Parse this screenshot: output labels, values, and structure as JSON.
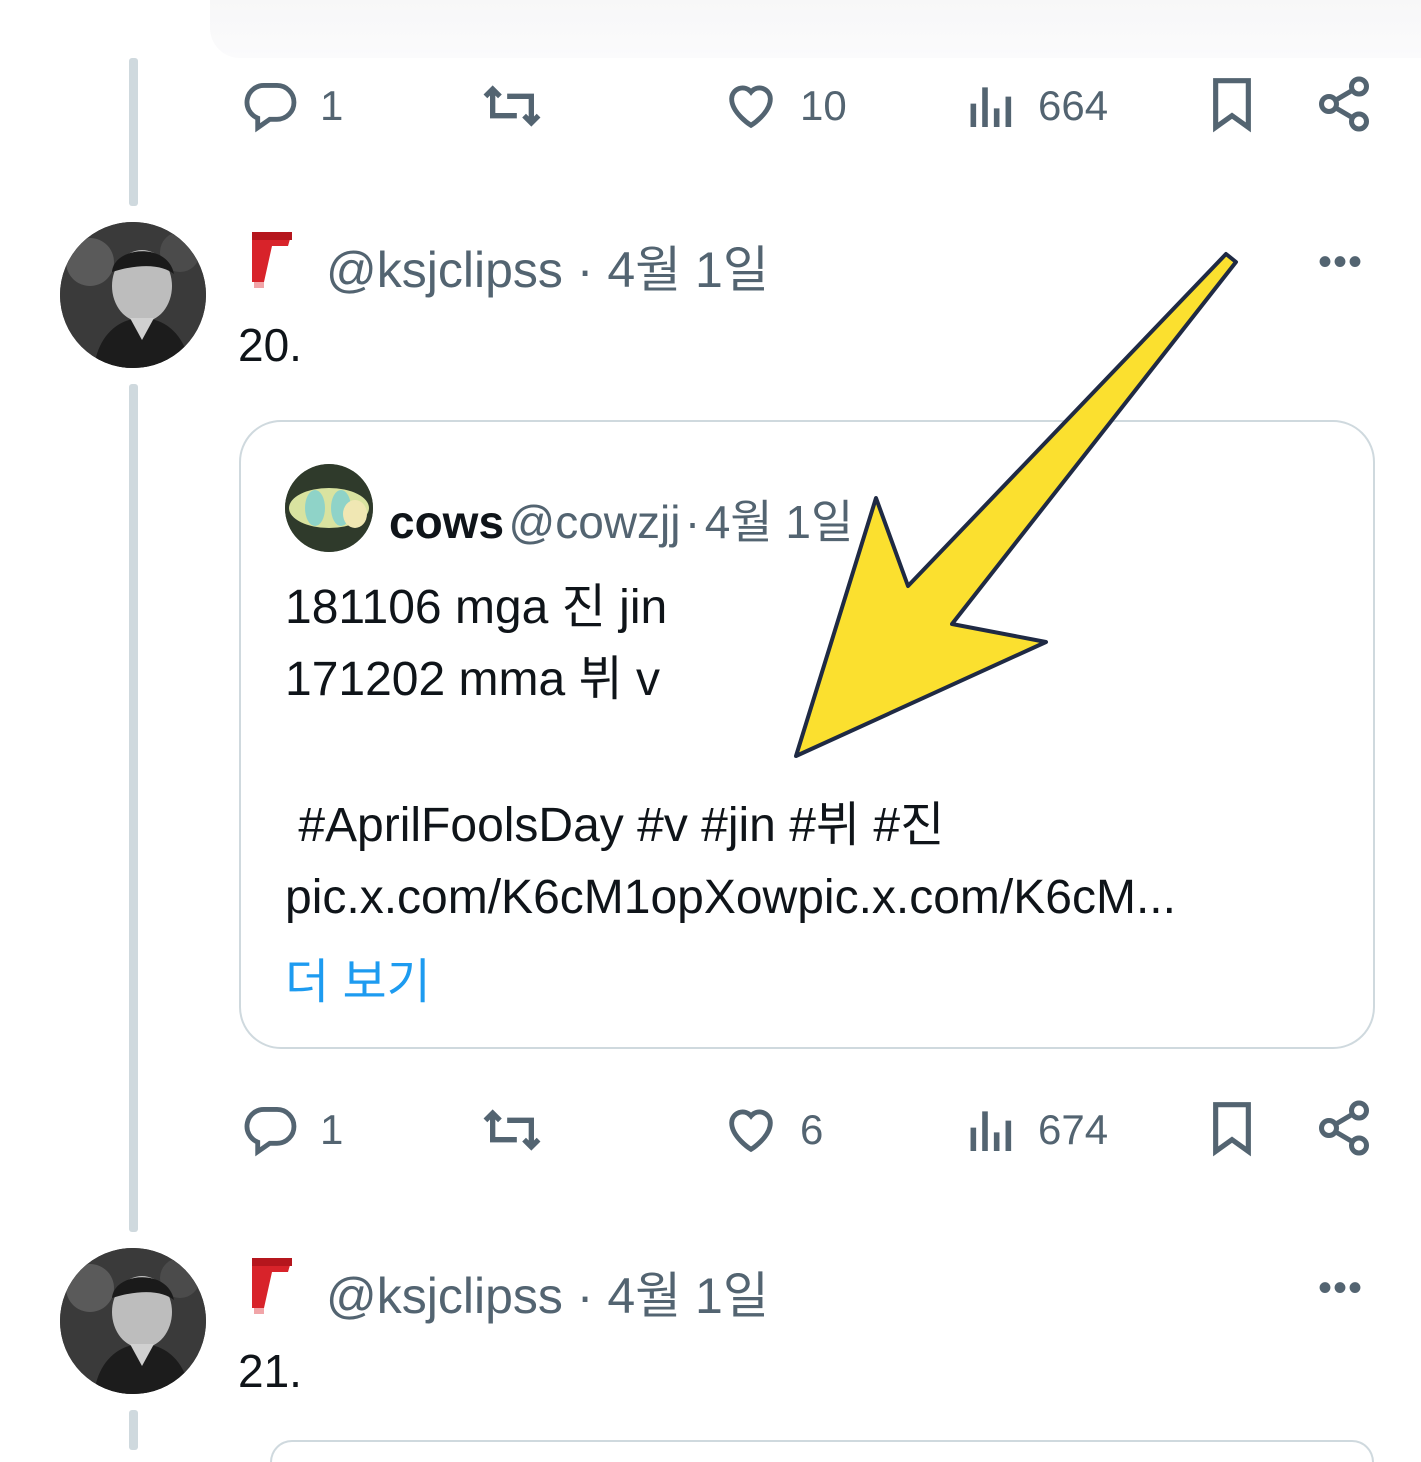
{
  "top_action_bar": {
    "reply_count": "1",
    "retweet_count": "",
    "like_count": "10",
    "view_count": "664"
  },
  "tweet_20": {
    "handle": "@ksjclipss",
    "separator": "·",
    "date": "4월 1일",
    "text": "20.",
    "more_label": "•••",
    "quote": {
      "name": "cows",
      "handle": "@cowzjj",
      "separator": "·",
      "date": "4월 1일",
      "line1": "181106 mga 진 jin",
      "line2": "171202 mma 뷔 v",
      "hashtags": " #AprilFoolsDay #v #jin #뷔 #진",
      "link": "pic.x.com/K6cM1opXowpic.x.com/K6cM...",
      "show_more": "더 보기"
    },
    "actions": {
      "reply_count": "1",
      "like_count": "6",
      "view_count": "674"
    }
  },
  "tweet_21": {
    "handle": "@ksjclipss",
    "separator": "·",
    "date": "4월 1일",
    "text": "21.",
    "more_label": "•••"
  },
  "colors": {
    "secondary_text": "#536471",
    "link_blue": "#1d9bf0",
    "thread_line": "#cfd9de",
    "arrow_fill": "#fbe02f",
    "scarf_red": "#d8232a"
  },
  "icons": [
    "reply-icon",
    "retweet-icon",
    "like-icon",
    "views-icon",
    "bookmark-icon",
    "share-icon",
    "scarf-emoji",
    "more-icon",
    "annotation-arrow"
  ]
}
